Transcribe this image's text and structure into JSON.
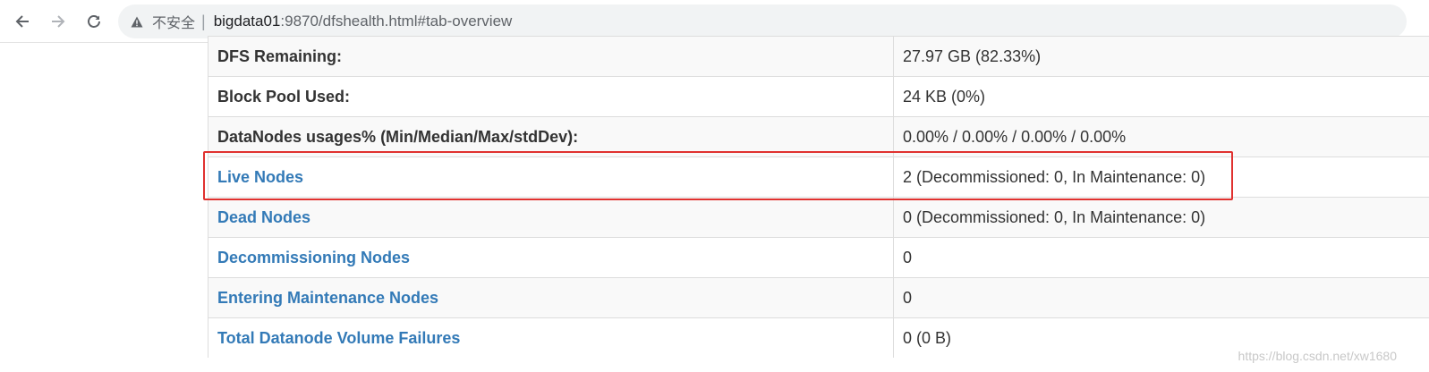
{
  "browser": {
    "security_label": "不安全",
    "url_host": "bigdata01",
    "url_rest": ":9870/dfshealth.html#tab-overview"
  },
  "icons": {
    "back": "arrow-left-icon",
    "forward": "arrow-right-icon",
    "reload": "reload-icon",
    "warning": "warning-triangle-icon"
  },
  "colors": {
    "link": "#337ab7",
    "highlight": "#e0312f",
    "row_stripe": "#f9f9f9"
  },
  "summary": {
    "rows": [
      {
        "label": "DFS Remaining:",
        "value": "27.97 GB (82.33%)"
      },
      {
        "label": "Block Pool Used:",
        "value": "24 KB (0%)"
      },
      {
        "label": "DataNodes usages% (Min/Median/Max/stdDev):",
        "value": "0.00% / 0.00% / 0.00% / 0.00%"
      },
      {
        "label": "Live Nodes",
        "value": "2 (Decommissioned: 0, In Maintenance: 0)"
      },
      {
        "label": "Dead Nodes",
        "value": "0 (Decommissioned: 0, In Maintenance: 0)"
      },
      {
        "label": "Decommissioning Nodes",
        "value": "0"
      },
      {
        "label": "Entering Maintenance Nodes",
        "value": "0"
      },
      {
        "label": "Total Datanode Volume Failures",
        "value": "0 (0 B)"
      }
    ]
  },
  "watermark": "https://blog.csdn.net/xw1680"
}
